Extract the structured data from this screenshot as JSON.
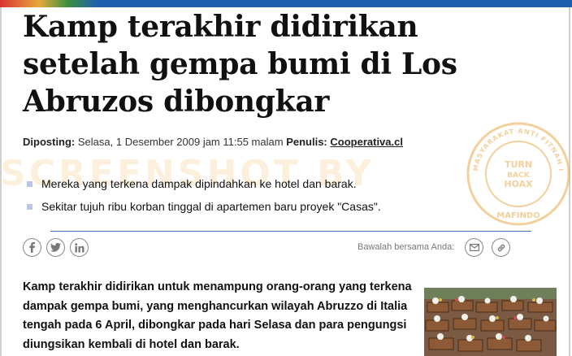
{
  "article": {
    "title": "Kamp terakhir didirikan setelah gempa bumi di Los Abruzos dibongkar",
    "byline": {
      "posted_label": "Diposting:",
      "date": "Selasa, 1 Desember 2009 jam 11:55 malam",
      "author_label": "Penulis:",
      "author": "Cooperativa.cl"
    },
    "bullets": [
      "Mereka yang terkena dampak dipindahkan ke hotel dan barak.",
      "Sekitar tujuh ribu korban tinggal di apartemen baru proyek \"Casas\"."
    ],
    "share": {
      "icons": [
        "facebook-icon",
        "twitter-icon",
        "linkedin-icon"
      ],
      "send_label": "Bawalah bersama Anda:",
      "send_icons": [
        "email-icon",
        "link-icon"
      ]
    },
    "lead": "Kamp terakhir didirikan untuk menampung orang-orang yang terkena dampak gempa bumi, yang menghancurkan wilayah Abruzzo di Italia tengah pada 6 April, dibongkar pada hari Selasa dan para pengungsi diungsikan kembali di hotel dan barak."
  },
  "overlay": {
    "watermark": "SCREENSHOT BY",
    "seal": {
      "ring_text": "MASYARAKAT ANTI FITNAH INDONESIA",
      "center_text": [
        "TURN",
        "BACK",
        "HOAX"
      ],
      "bottom_text": "MAFINDO",
      "color": "#e8a23a"
    }
  },
  "colors": {
    "topbar": "#1e5fae",
    "rule": "#3d6fb5",
    "bullet": "#b9c7e6"
  }
}
